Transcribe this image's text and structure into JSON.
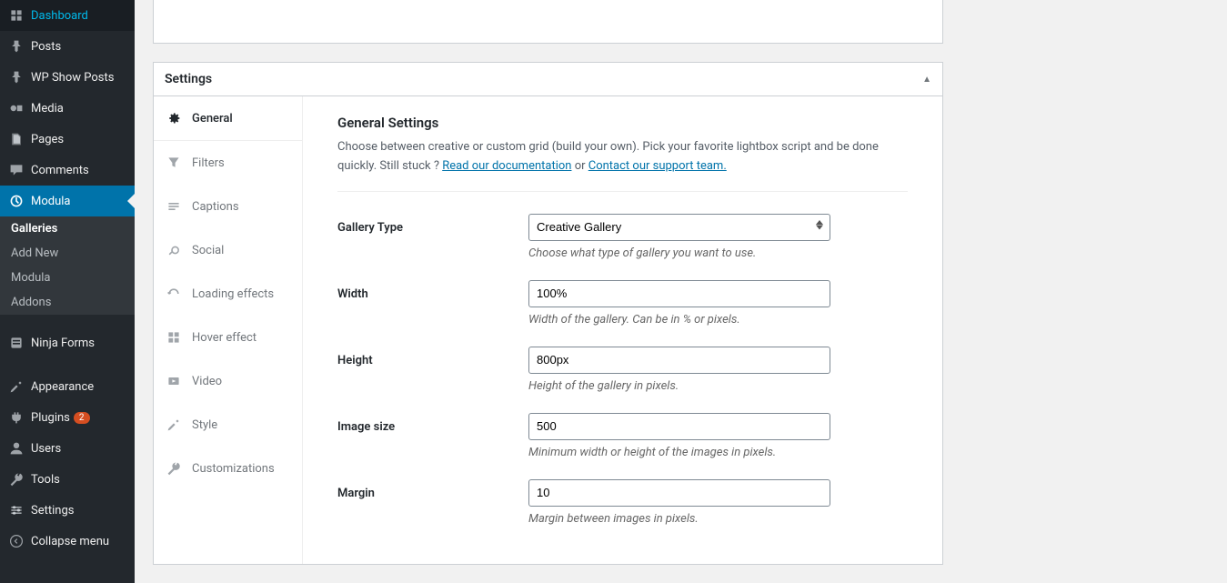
{
  "sidebar": {
    "items": [
      {
        "label": "Dashboard",
        "icon": "dashboard-icon"
      },
      {
        "label": "Posts",
        "icon": "pin-icon"
      },
      {
        "label": "WP Show Posts",
        "icon": "pin-icon"
      },
      {
        "label": "Media",
        "icon": "media-icon"
      },
      {
        "label": "Pages",
        "icon": "pages-icon"
      },
      {
        "label": "Comments",
        "icon": "comments-icon"
      },
      {
        "label": "Modula",
        "icon": "modula-icon"
      },
      {
        "label": "Ninja Forms",
        "icon": "forms-icon"
      },
      {
        "label": "Appearance",
        "icon": "appearance-icon"
      },
      {
        "label": "Plugins",
        "icon": "plugins-icon",
        "badge": "2"
      },
      {
        "label": "Users",
        "icon": "users-icon"
      },
      {
        "label": "Tools",
        "icon": "tools-icon"
      },
      {
        "label": "Settings",
        "icon": "settings-icon"
      },
      {
        "label": "Collapse menu",
        "icon": "collapse-icon"
      }
    ],
    "submenu": [
      {
        "label": "Galleries",
        "active": true
      },
      {
        "label": "Add New"
      },
      {
        "label": "Modula"
      },
      {
        "label": "Addons"
      }
    ]
  },
  "panel": {
    "title": "Settings"
  },
  "tabs": [
    {
      "label": "General"
    },
    {
      "label": "Filters"
    },
    {
      "label": "Captions"
    },
    {
      "label": "Social"
    },
    {
      "label": "Loading effects"
    },
    {
      "label": "Hover effect"
    },
    {
      "label": "Video"
    },
    {
      "label": "Style"
    },
    {
      "label": "Customizations"
    }
  ],
  "form": {
    "heading": "General Settings",
    "description_1": "Choose between creative or custom grid (build your own). Pick your favorite lightbox script and be done quickly. Still stuck ? ",
    "link_docs": "Read our documentation",
    "desc_or": " or ",
    "link_support": "Contact our support team.",
    "gallery_type": {
      "label": "Gallery Type",
      "value": "Creative Gallery",
      "hint": "Choose what type of gallery you want to use."
    },
    "width": {
      "label": "Width",
      "value": "100%",
      "hint": "Width of the gallery. Can be in % or pixels."
    },
    "height": {
      "label": "Height",
      "value": "800px",
      "hint": "Height of the gallery in pixels."
    },
    "image_size": {
      "label": "Image size",
      "value": "500",
      "hint": "Minimum width or height of the images in pixels."
    },
    "margin": {
      "label": "Margin",
      "value": "10",
      "hint": "Margin between images in pixels."
    }
  }
}
